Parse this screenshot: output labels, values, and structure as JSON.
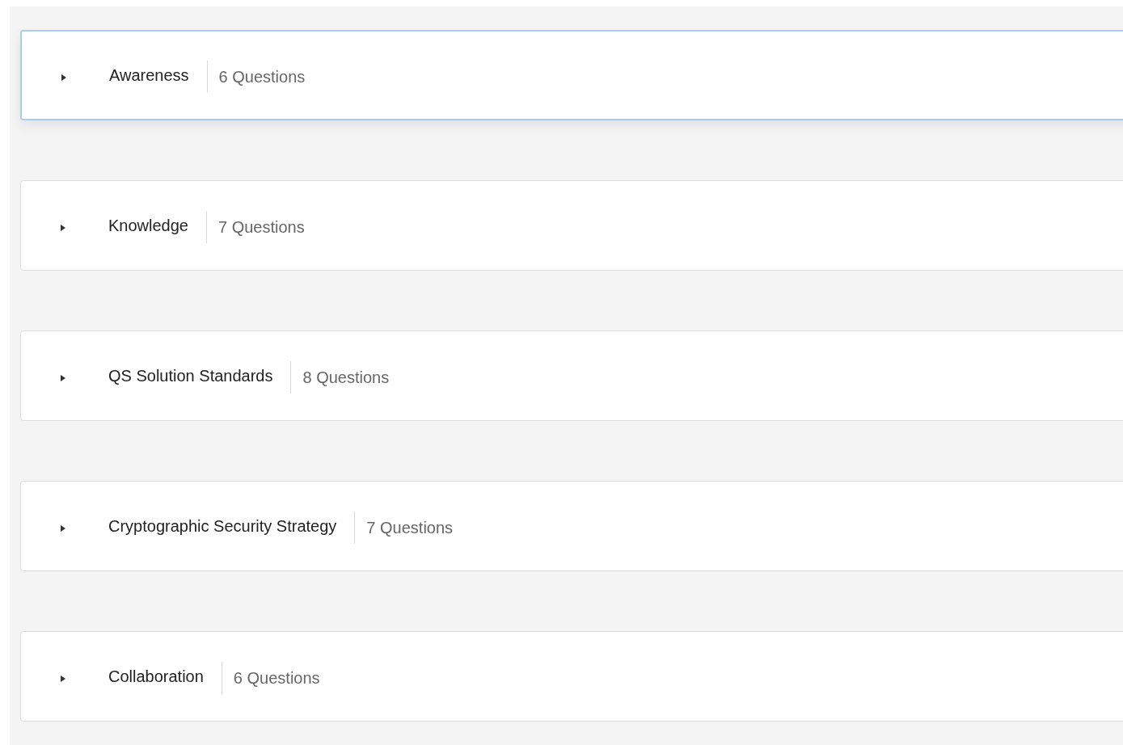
{
  "blocks": [
    {
      "title": "Awareness",
      "count": "6 Questions",
      "selected": true,
      "expanded": false
    },
    {
      "title": "Knowledge",
      "count": "7 Questions",
      "selected": false,
      "expanded": false
    },
    {
      "title": "QS Solution Standards",
      "count": "8 Questions",
      "selected": false,
      "expanded": false
    },
    {
      "title": "Cryptographic Security Strategy",
      "count": "7 Questions",
      "selected": false,
      "expanded": false
    },
    {
      "title": "Collaboration",
      "count": "6 Questions",
      "selected": false,
      "expanded": false
    }
  ]
}
